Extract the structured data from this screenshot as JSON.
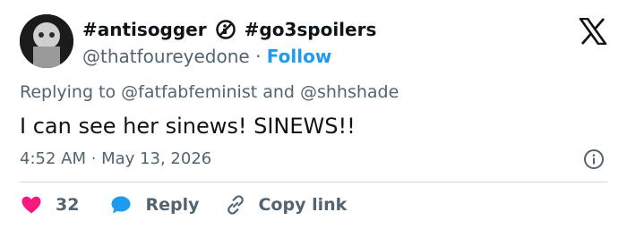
{
  "author": {
    "display_name_part1": "#antisogger",
    "display_name_part2": "#go3spoilers",
    "handle": "@thatfoureyedone",
    "separator": "·",
    "follow_label": "Follow",
    "name_icon": "no-entry-icon"
  },
  "tweet": {
    "replying_to": "Replying to @fatfabfeminist and @shhshade",
    "text": "I can see her sinews! SINEWS!!",
    "timestamp": "4:52 AM · May 13, 2026"
  },
  "actions": {
    "like_count": "32",
    "reply_label": "Reply",
    "copy_link_label": "Copy link"
  },
  "colors": {
    "accent": "#1d9bf0",
    "like": "#f91880",
    "muted": "#536471",
    "text": "#0f1419"
  }
}
